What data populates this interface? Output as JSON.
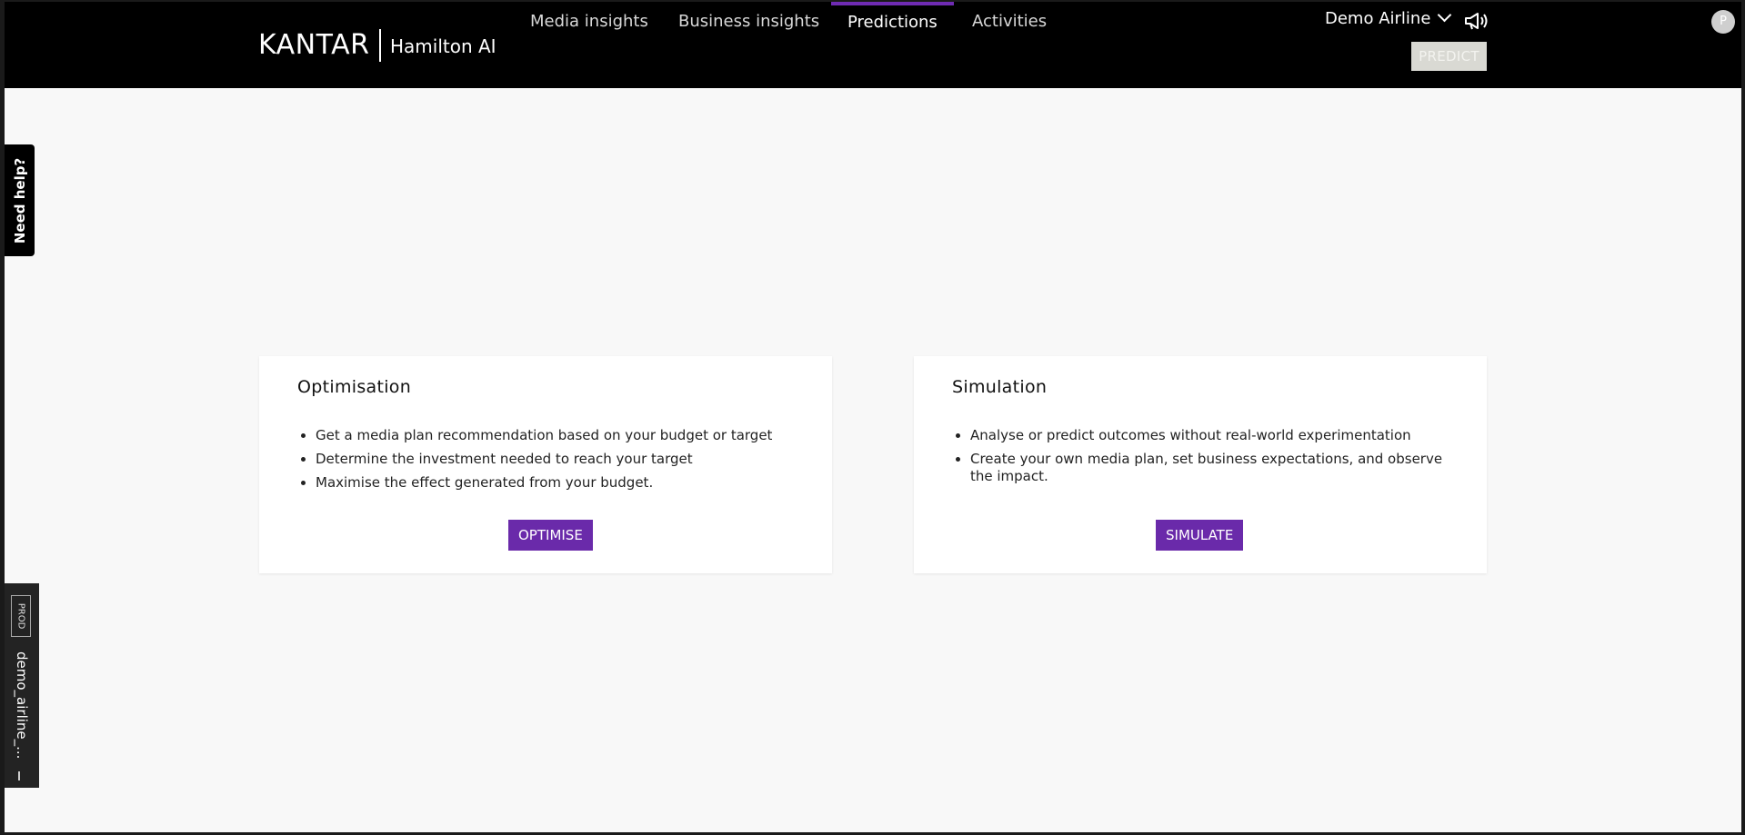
{
  "header": {
    "brand": "KANTAR",
    "product": "Hamilton AI",
    "tabs": [
      {
        "label": "Media insights"
      },
      {
        "label": "Business insights"
      },
      {
        "label": "Predictions"
      },
      {
        "label": "Activities"
      }
    ],
    "active_tab": "Predictions",
    "client": "Demo Airline",
    "predict_label": "PREDICT",
    "avatar_initial": "P"
  },
  "help_tab": {
    "label": "Need help?"
  },
  "environment": {
    "badge": "PROD",
    "name": "demo_airline_..."
  },
  "cards": [
    {
      "title": "Optimisation",
      "bullets": [
        "Get a media plan recommendation based on your budget or target",
        "Determine the investment needed to reach your target",
        "Maximise the effect generated from your budget."
      ],
      "button": "OPTIMISE"
    },
    {
      "title": "Simulation",
      "bullets": [
        "Analyse or predict outcomes without real-world experimentation",
        "Create your own media plan, set business expectations, and observe the impact."
      ],
      "button": "SIMULATE"
    }
  ],
  "colors": {
    "accent": "#6a2aaa",
    "header_bg": "#000000",
    "page_bg": "#f8f8f8"
  }
}
